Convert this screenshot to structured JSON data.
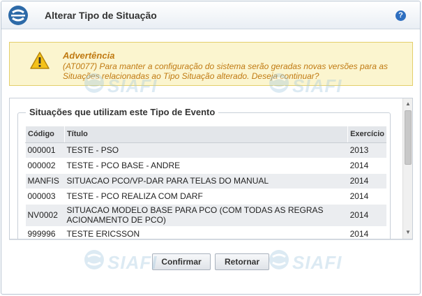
{
  "window": {
    "title": "Alterar Tipo de Situação",
    "help_label": "?"
  },
  "warning": {
    "title": "Advertência",
    "message": "(AT0077) Para manter a configuração do sistema serão geradas novas versões para as Situações relacionadas ao Tipo Situação alterado. Deseja continuar?"
  },
  "section": {
    "legend": "Situações que utilizam este Tipo de Evento"
  },
  "table": {
    "columns": [
      "Código",
      "Título",
      "Exercício"
    ],
    "rows": [
      [
        "000001",
        "TESTE - PSO",
        "2013"
      ],
      [
        "000002",
        "TESTE - PCO BASE - ANDRE",
        "2014"
      ],
      [
        "MANFIS",
        "SITUACAO PCO/VP-DAR PARA TELAS DO MANUAL",
        "2014"
      ],
      [
        "000003",
        "TESTE - PCO REALIZA COM DARF",
        "2014"
      ],
      [
        "NV0002",
        "SITUACAO MODELO BASE PARA PCO (COM TODAS AS REGRAS ACIONAMENTO DE PCO)",
        "2014"
      ],
      [
        "999996",
        "TESTE ERICSSON",
        "2014"
      ]
    ]
  },
  "buttons": {
    "confirm": "Confirmar",
    "return": "Retornar"
  },
  "watermark": {
    "text": "SIAFI"
  },
  "colors": {
    "accent": "#2d6aa8",
    "warning_text": "#c07a12",
    "warning_bg": "#fbf5cf"
  }
}
